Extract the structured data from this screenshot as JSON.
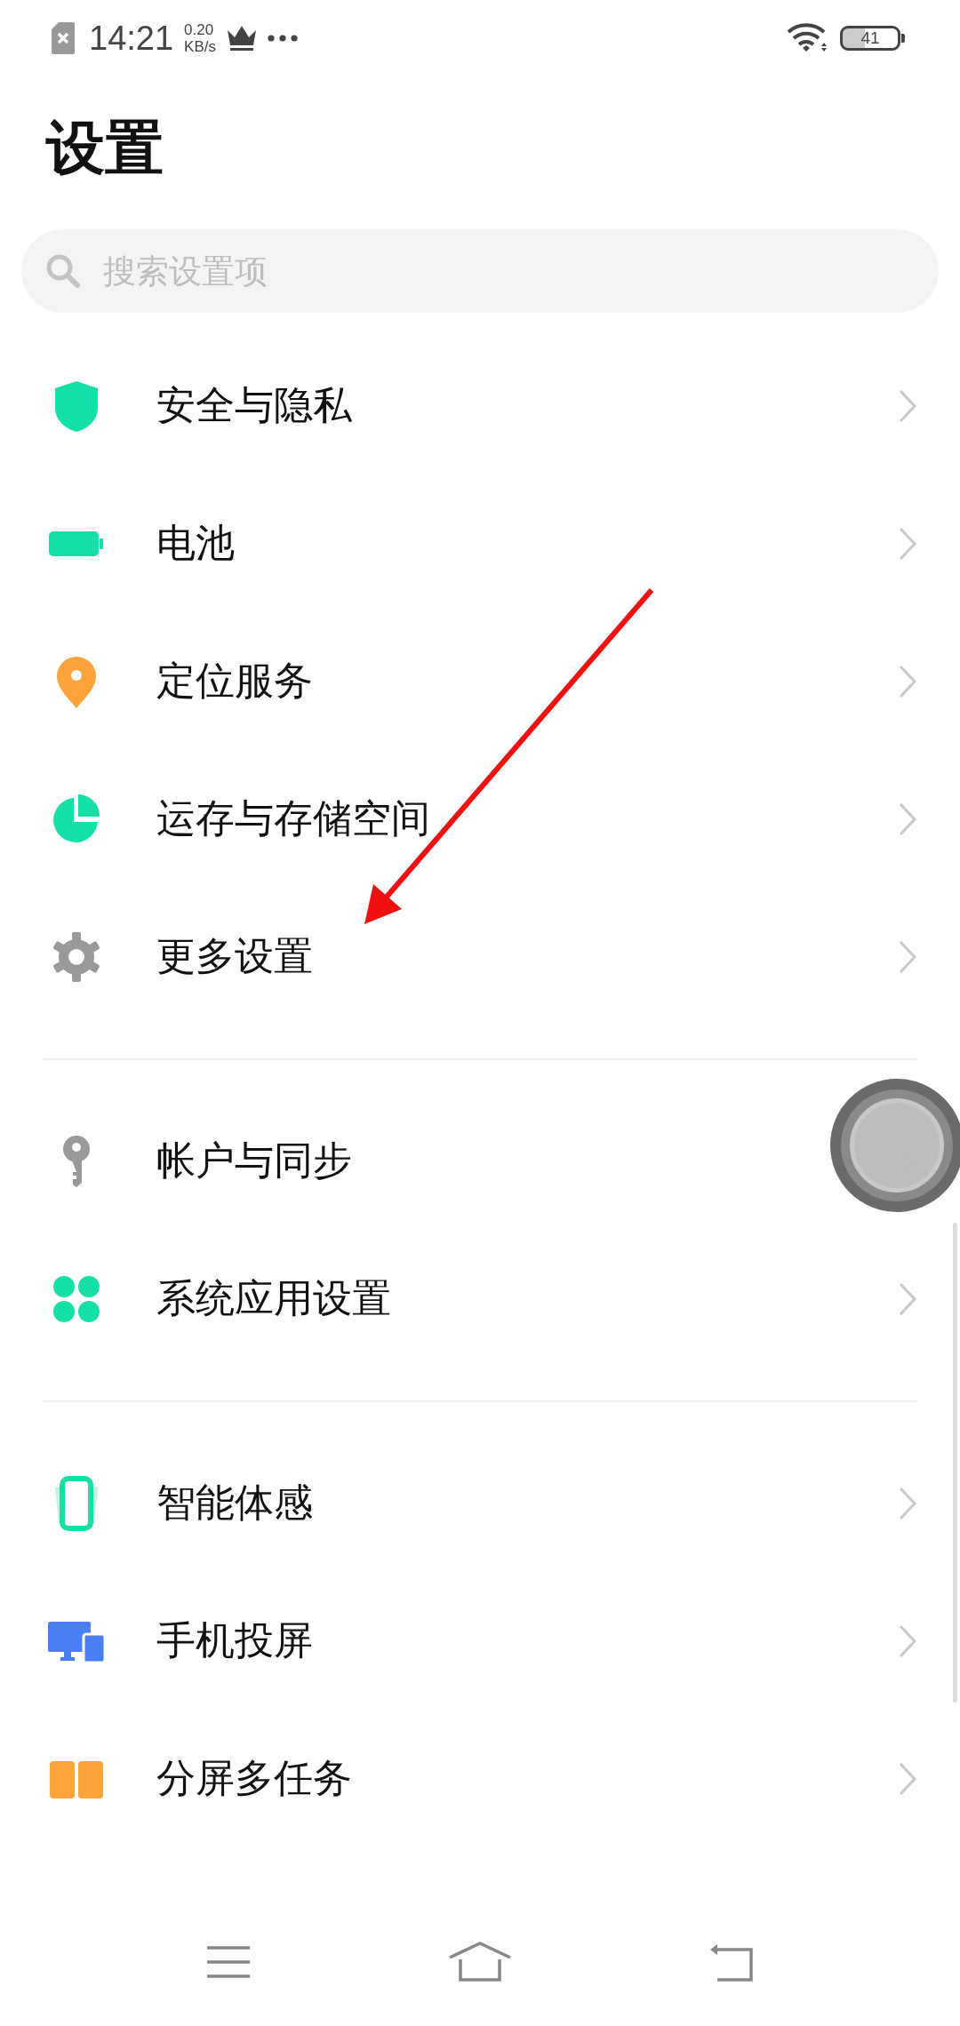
{
  "status_bar": {
    "time": "14:21",
    "speed": "0.20",
    "speed_unit": "KB/s",
    "battery": "41"
  },
  "title": "设置",
  "search": {
    "placeholder": "搜索设置项"
  },
  "sections": [
    [
      {
        "label": "安全与隐私"
      },
      {
        "label": "电池"
      },
      {
        "label": "定位服务"
      },
      {
        "label": "运存与存储空间"
      },
      {
        "label": "更多设置"
      }
    ],
    [
      {
        "label": "帐户与同步"
      },
      {
        "label": "系统应用设置"
      }
    ],
    [
      {
        "label": "智能体感"
      },
      {
        "label": "手机投屏"
      },
      {
        "label": "分屏多任务"
      }
    ]
  ]
}
